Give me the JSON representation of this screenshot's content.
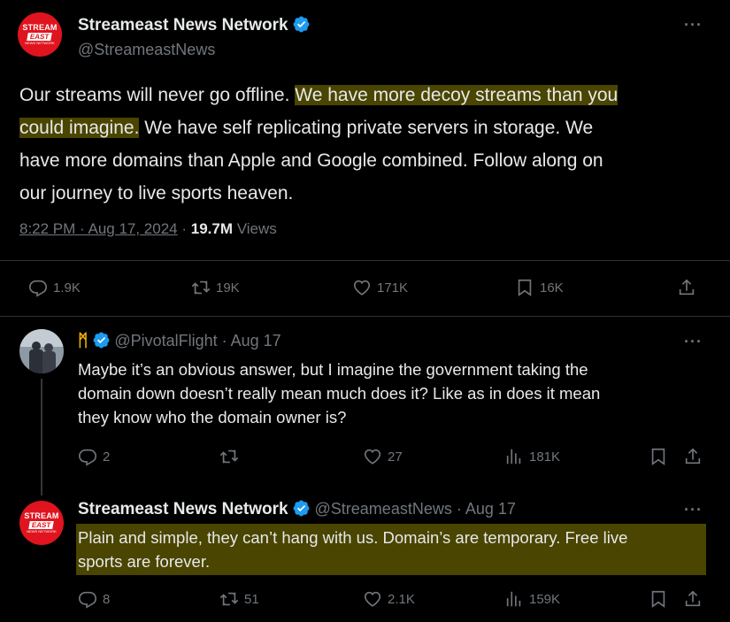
{
  "main_tweet": {
    "author_name": "Streameast News Network",
    "author_handle": "@StreameastNews",
    "avatar": {
      "line1": "STREAM",
      "line2": "EAST",
      "line3": "NEWS NETWORK"
    },
    "text_line1_plain": "Our streams will never go offline. ",
    "text_line1_highlight": "We have more decoy streams than you",
    "text_line2_highlight": "could imagine.",
    "text_line2_plain": " We have self replicating private servers in storage. We",
    "text_line3": "have more domains than Apple and Google combined. Follow along on",
    "text_line4": "our journey to live sports heaven.",
    "time": "8:22 PM · Aug 17, 2024",
    "sep": " · ",
    "views_count": "19.7M",
    "views_label": " Views",
    "replies": "1.9K",
    "reposts": "19K",
    "likes": "171K",
    "bookmarks": "16K",
    "more": "···"
  },
  "reply1": {
    "author_name": "ᛗ",
    "author_handle": "@PivotalFlight",
    "date": " · Aug 17",
    "line1": "Maybe it’s an obvious answer, but I imagine the government taking the",
    "line2": "domain down doesn’t really mean much does it? Like as in does it mean",
    "line3": "they know who the domain owner is?",
    "replies": "2",
    "likes": "27",
    "views": "181K",
    "more": "···"
  },
  "reply2": {
    "author_name": "Streameast News Network",
    "author_handle": "@StreameastNews",
    "date": " · Aug 17",
    "line1": "Plain and simple, they can’t hang with us. Domain’s are temporary. Free live",
    "line2": "sports are forever.",
    "replies": "8",
    "reposts": "51",
    "likes": "2.1K",
    "views": "159K",
    "more": "···"
  },
  "colors": {
    "background": "#000000",
    "verified": "#1d9bf0",
    "highlight": "#4a4500",
    "muted": "#71767b",
    "brand_red": "#e0141e"
  }
}
